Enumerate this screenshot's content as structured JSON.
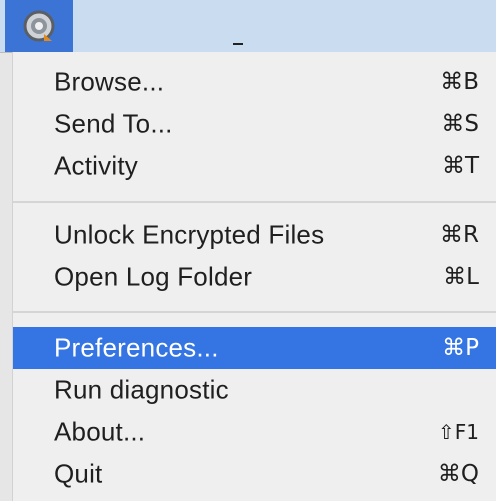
{
  "colors": {
    "menubar": "#c9dcf0",
    "status_item_bg": "#3c74d6",
    "menu_bg": "#efefef",
    "highlight": "#3574e3",
    "text": "#1f1f1f"
  },
  "menubar": {
    "status_icon": "app-status-icon"
  },
  "menu": {
    "items": [
      {
        "label": "Browse...",
        "shortcut": "⌘B"
      },
      {
        "label": "Send To...",
        "shortcut": "⌘S"
      },
      {
        "label": "Activity",
        "shortcut": "⌘T"
      },
      {
        "label": "Unlock Encrypted Files",
        "shortcut": "⌘R"
      },
      {
        "label": "Open Log Folder",
        "shortcut": "⌘L"
      },
      {
        "label": "Preferences...",
        "shortcut": "⌘P",
        "highlighted": true
      },
      {
        "label": "Run diagnostic",
        "shortcut": ""
      },
      {
        "label": "About...",
        "shortcut": "⇧F1"
      },
      {
        "label": "Quit",
        "shortcut": "⌘Q"
      }
    ]
  }
}
